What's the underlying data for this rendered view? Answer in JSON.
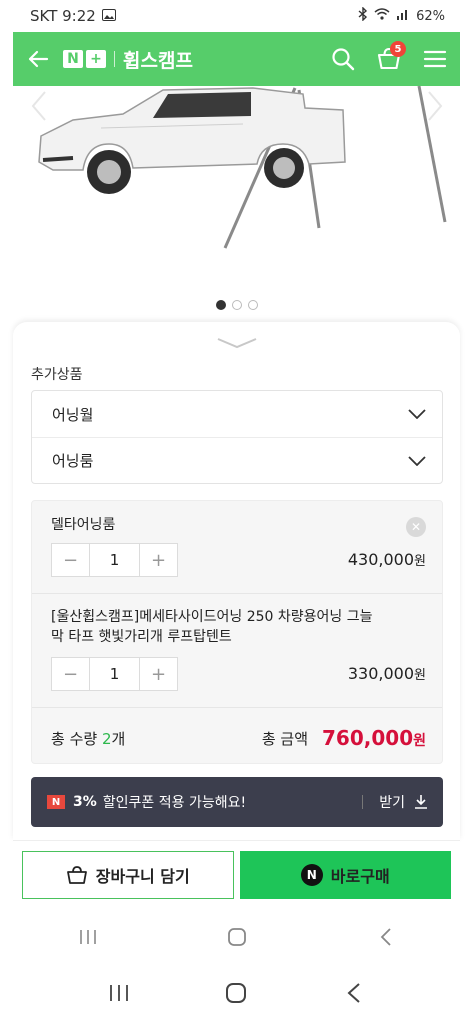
{
  "status_bar": {
    "carrier_time": "SKT 9:22",
    "battery": "62%"
  },
  "header": {
    "nplus_n": "N",
    "nplus_plus": "+",
    "store_name": "휩스캠프",
    "cart_count": "5",
    "icons": [
      "back-arrow-icon",
      "search-icon",
      "cart-icon",
      "menu-icon"
    ]
  },
  "hero": {
    "slide_count": 3,
    "active_slide": 1
  },
  "options": {
    "section_label": "추가상품",
    "selects": [
      {
        "label": "어닝월"
      },
      {
        "label": "어닝룸"
      }
    ]
  },
  "cart_items": [
    {
      "name": "델타어닝룸",
      "quantity": "1",
      "price": "430,000",
      "unit": "원"
    },
    {
      "name_line1": "[울산휩스캠프]메세타사이드어닝 250 차량용어닝 그늘",
      "name_line2": "막 타프 햇빛가리개 루프탑텐트",
      "quantity": "1",
      "price": "330,000",
      "unit": "원"
    }
  ],
  "totals": {
    "qty_label": "총 수량",
    "qty_value": "2",
    "qty_unit": "개",
    "amount_label": "총 금액",
    "amount": "760,000",
    "amount_unit": "원"
  },
  "coupon": {
    "badge": "N",
    "percent": "3%",
    "text": "할인쿠폰 적용 가능해요!",
    "action": "받기"
  },
  "actions": {
    "cart_label": "장바구니 담기",
    "buy_badge": "N",
    "buy_label": "바로구매"
  },
  "colors": {
    "brand_green": "#56cd6a",
    "buy_green": "#1ec558",
    "price_red": "#d5103b",
    "coupon_bg": "#3c3e4d"
  }
}
